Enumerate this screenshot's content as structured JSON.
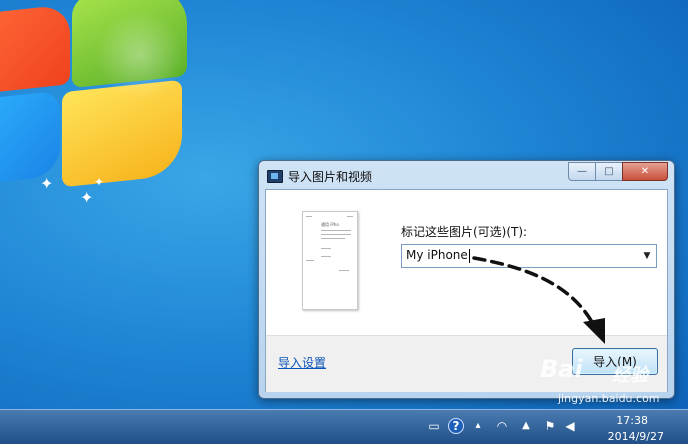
{
  "dialog": {
    "title": "导入图片和视频",
    "tag_label": "标记这些图片(可选)(T):",
    "tag_value": "My iPhone",
    "settings_link": "导入设置",
    "import_button": "导入(M)",
    "caption": {
      "minimize": "—",
      "maximize": "□",
      "close": "✕"
    }
  },
  "thumbnail": {
    "title": "通用 iPho"
  },
  "taskbar": {
    "time": "17:38",
    "date": "2014/9/27",
    "help_glyph": "?"
  },
  "watermark": {
    "logo": "Bai",
    "text": "经验",
    "url": "jingyan.baidu.com"
  },
  "colors": {
    "link": "#0b54b8",
    "desktop": "#1f86d6"
  }
}
